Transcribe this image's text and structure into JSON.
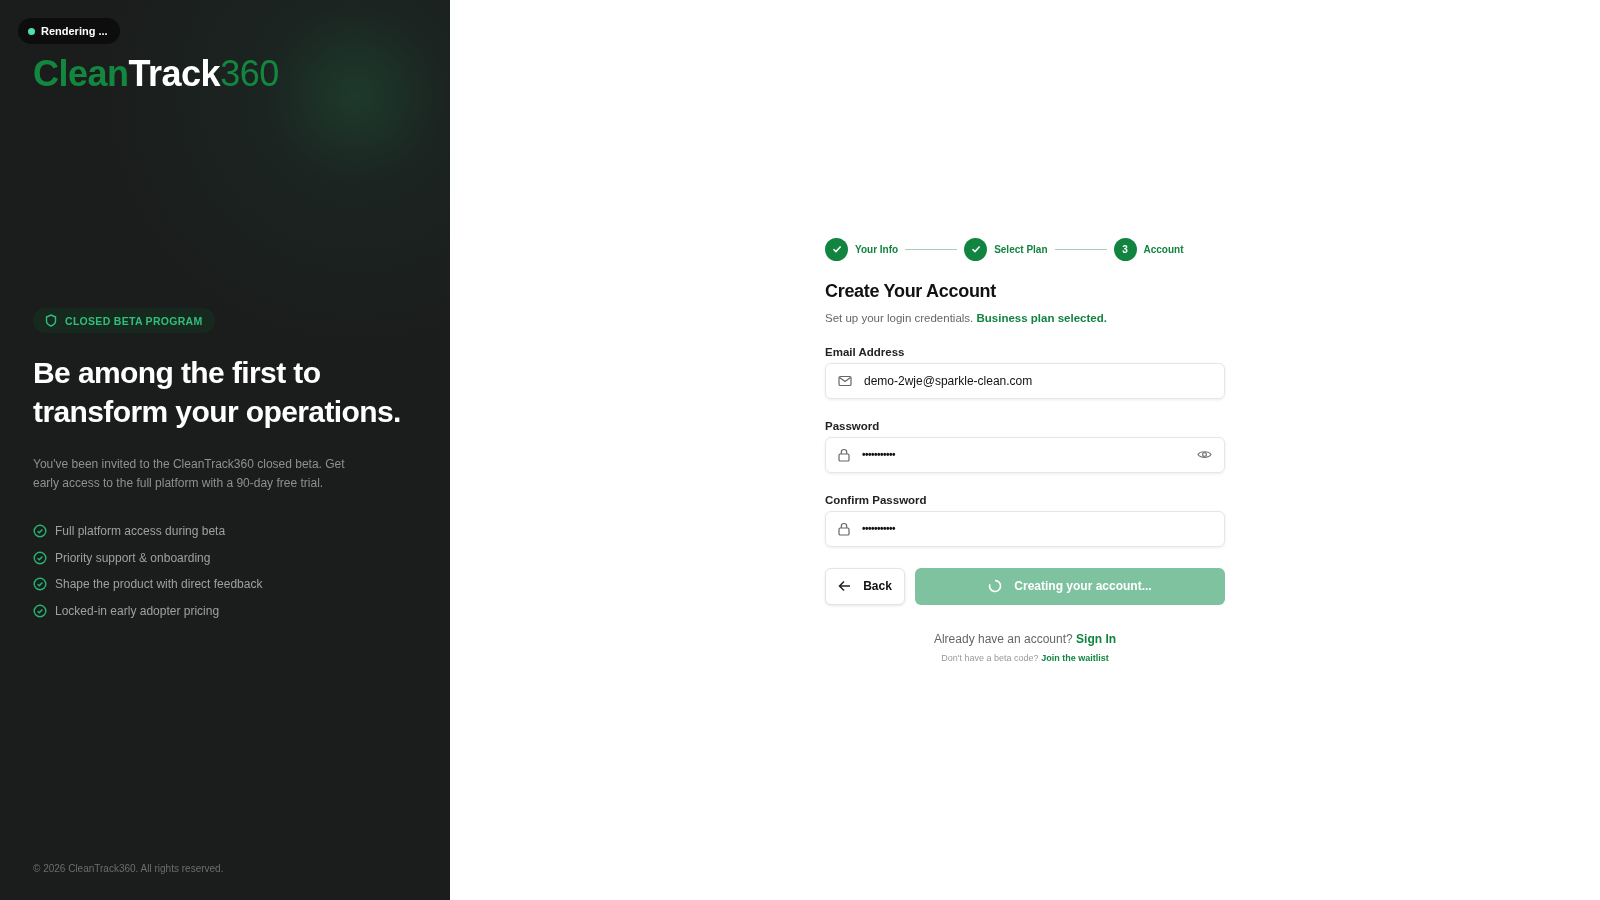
{
  "status_badge": {
    "label": "Rendering ..."
  },
  "brand": {
    "parts": [
      "Clean",
      "Track",
      "360"
    ]
  },
  "promo": {
    "pill": "CLOSED BETA PROGRAM",
    "heading": "Be among the first to transform your operations.",
    "body": "You've been invited to the CleanTrack360 closed beta. Get early access to the full platform with a 90-day free trial.",
    "features": [
      "Full platform access during beta",
      "Priority support & onboarding",
      "Shape the product with direct feedback",
      "Locked-in early adopter pricing"
    ],
    "footer": "© 2026 CleanTrack360. All rights reserved."
  },
  "stepper": [
    {
      "label": "Your Info",
      "done": true
    },
    {
      "label": "Select Plan",
      "done": true
    },
    {
      "label": "Account",
      "number": "3",
      "done": false
    }
  ],
  "form": {
    "title": "Create Your Account",
    "subtitle": "Set up your login credentials. **Business plan selected.**",
    "fields": [
      {
        "label": "Email Address",
        "kind": "email",
        "value": "demo-2wje@sparkle-clean.com",
        "reveal": false
      },
      {
        "label": "Password",
        "kind": "password",
        "value": "•••••••••••",
        "reveal": true
      },
      {
        "label": "Confirm Password",
        "kind": "password",
        "value": "•••••••••••",
        "reveal": false
      }
    ],
    "back": "Back",
    "submit": {
      "label": "Creating your account...",
      "loading": true
    },
    "signin": {
      "text": "Already have an account?",
      "link": "Sign In"
    },
    "waitlist": {
      "text": "Don't have a beta code?",
      "link": "Join the waitlist"
    }
  }
}
